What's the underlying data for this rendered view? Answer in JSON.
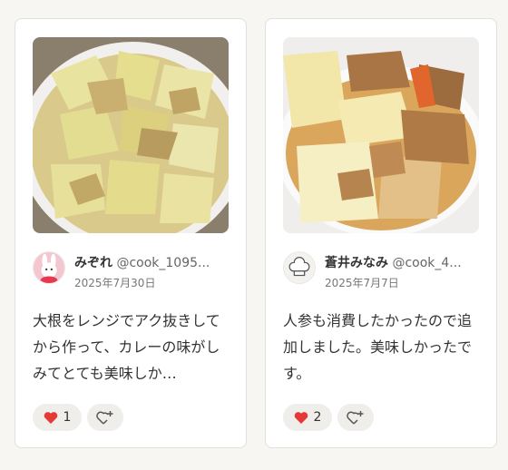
{
  "cards": [
    {
      "author_name": "みぞれ",
      "author_id": "@cook_1095...",
      "date": "2025年7月30日",
      "comment": "大根をレンジでアク抜きしてから作って、カレーの味がしみてとても美味しか…",
      "like_count": "1",
      "photo_icon": "daikon-curry-photo",
      "avatar_icon": "rabbit-avatar-icon"
    },
    {
      "author_name": "蒼井みなみ",
      "author_id": "@cook_4...",
      "date": "2025年7月7日",
      "comment": "人参も消費したかったので追加しました。美味しかったです。",
      "like_count": "2",
      "photo_icon": "daikon-nimono-photo",
      "avatar_icon": "chef-hat-avatar-icon"
    }
  ],
  "colors": {
    "card_bg": "#ffffff",
    "page_bg": "#f7f6f2",
    "button_bg": "#efeeea",
    "heart": "#e53935"
  }
}
